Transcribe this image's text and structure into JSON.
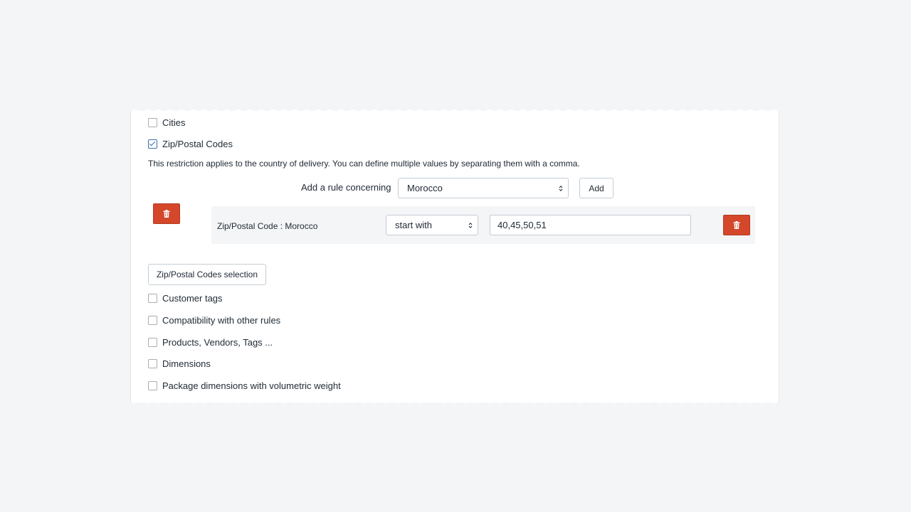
{
  "checkboxes_top": [
    {
      "label": "Cities",
      "checked": false
    },
    {
      "label": "Zip/Postal Codes",
      "checked": true
    }
  ],
  "help_text": "This restriction applies to the country of delivery. You can define multiple values by separating them with a comma.",
  "rule_builder": {
    "label": "Add a rule concerning",
    "country_select": "Morocco",
    "add_button": "Add"
  },
  "rule": {
    "label": "Zip/Postal Code : Morocco",
    "condition": "start with",
    "value": "40,45,50,51"
  },
  "selection_button": "Zip/Postal Codes selection",
  "checkboxes_bottom": [
    {
      "label": "Customer tags",
      "checked": false
    },
    {
      "label": "Compatibility with other rules",
      "checked": false
    },
    {
      "label": "Products, Vendors, Tags ...",
      "checked": false
    },
    {
      "label": "Dimensions",
      "checked": false
    },
    {
      "label": "Package dimensions with volumetric weight",
      "checked": false
    }
  ],
  "colors": {
    "delete_button": "#d4472a",
    "checkbox_checked": "#3c6bb4",
    "page_background": "#f4f5f7"
  },
  "icons": {
    "delete": "trash-icon",
    "select": "select-arrows-icon"
  }
}
